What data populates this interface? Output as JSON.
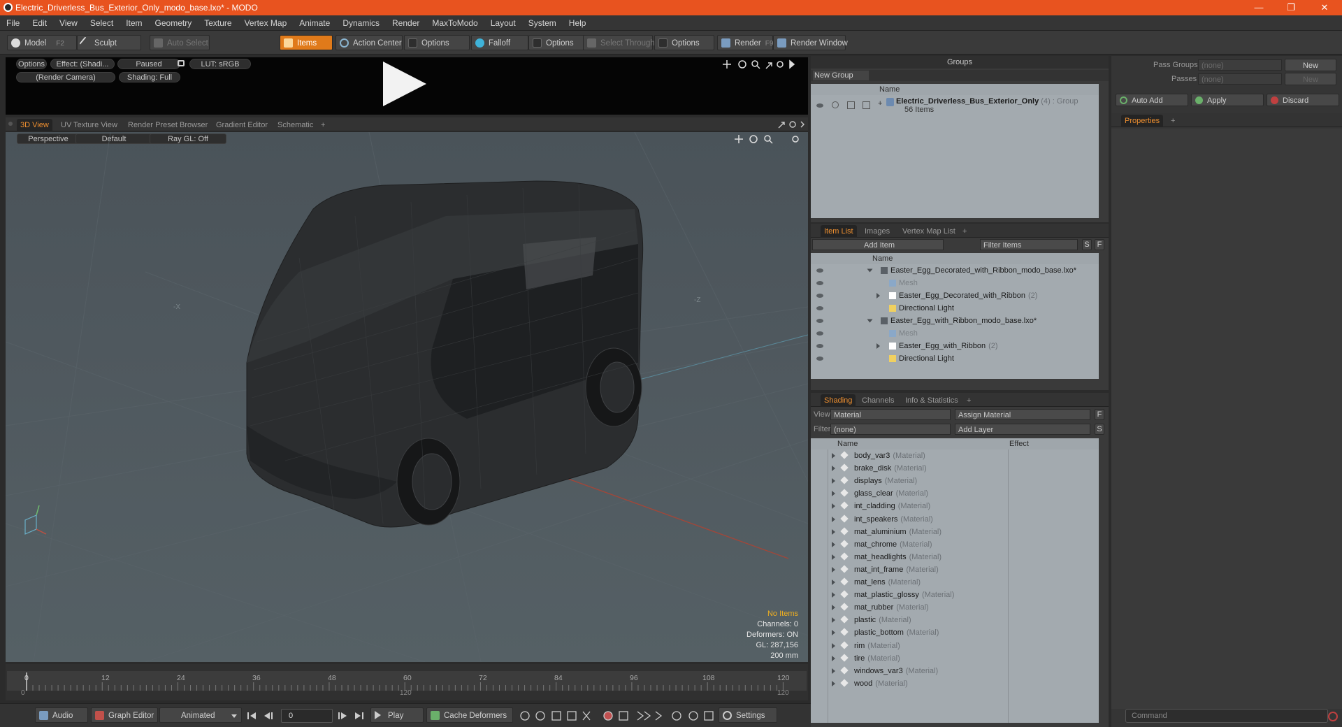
{
  "window": {
    "title": "Electric_Driverless_Bus_Exterior_Only_modo_base.lxo* - MODO",
    "minimize": "—",
    "maximize": "❐",
    "close": "✕"
  },
  "menu": [
    "File",
    "Edit",
    "View",
    "Select",
    "Item",
    "Geometry",
    "Texture",
    "Vertex Map",
    "Animate",
    "Dynamics",
    "Render",
    "MaxToModo",
    "Layout",
    "System",
    "Help"
  ],
  "toolbar": {
    "model": "Model",
    "model_key": "F2",
    "sculpt": "Sculpt",
    "auto_select": "Auto Select",
    "items": "Items",
    "action_center": "Action Center",
    "options1": "Options",
    "falloff": "Falloff",
    "options2": "Options",
    "select_through": "Select Through",
    "options3": "Options",
    "render": "Render",
    "render_key": "F9",
    "render_window": "Render Window"
  },
  "preview": {
    "options": "Options",
    "effect": "Effect: (Shadi...",
    "paused": "Paused",
    "lut": "LUT: sRGB",
    "camera": "(Render Camera)",
    "shading": "Shading: Full"
  },
  "view_tabs": [
    "3D View",
    "UV Texture View",
    "Render Preset Browser",
    "Gradient Editor",
    "Schematic",
    "+"
  ],
  "viewport": {
    "perspective": "Perspective",
    "default": "Default",
    "raygl": "Ray GL: Off",
    "axis_x": "-X",
    "axis_z": "-Z",
    "stats": {
      "no_items": "No Items",
      "channels": "Channels: 0",
      "deformers": "Deformers: ON",
      "gl": "GL: 287,156",
      "size": "200 mm"
    }
  },
  "timeline": {
    "ticks": [
      "0",
      "12",
      "24",
      "36",
      "48",
      "60",
      "72",
      "84",
      "96",
      "108",
      "120"
    ],
    "range_start": "0",
    "range_mid": "120",
    "range_end": "120"
  },
  "bottombar": {
    "audio": "Audio",
    "graph_editor": "Graph Editor",
    "animated": "Animated",
    "frame": "0",
    "play": "Play",
    "cache": "Cache Deformers",
    "settings": "Settings"
  },
  "groups": {
    "title": "Groups",
    "new_group": "New Group",
    "col_name": "Name",
    "item_name": "Electric_Driverless_Bus_Exterior_Only",
    "item_count": "(4)",
    "item_type": ": Group",
    "item_sub": "56 Items"
  },
  "item_list": {
    "tabs": [
      "Item List",
      "Images",
      "Vertex Map List",
      "+"
    ],
    "add_item": "Add Item",
    "filter": "Filter Items",
    "s": "S",
    "f": "F",
    "col_name": "Name",
    "rows": [
      {
        "label": "Easter_Egg_Decorated_with_Ribbon_modo_base.lxo*",
        "dim": "",
        "indent": 0,
        "kind": "scene"
      },
      {
        "label": "Mesh",
        "dim": "",
        "indent": 1,
        "kind": "mesh"
      },
      {
        "label": "Easter_Egg_Decorated_with_Ribbon",
        "dim": "(2)",
        "indent": 1,
        "kind": "group"
      },
      {
        "label": "Directional Light",
        "dim": "",
        "indent": 1,
        "kind": "light"
      },
      {
        "label": "Easter_Egg_with_Ribbon_modo_base.lxo*",
        "dim": "",
        "indent": 0,
        "kind": "scene"
      },
      {
        "label": "Mesh",
        "dim": "",
        "indent": 1,
        "kind": "mesh"
      },
      {
        "label": "Easter_Egg_with_Ribbon",
        "dim": "(2)",
        "indent": 1,
        "kind": "group"
      },
      {
        "label": "Directional Light",
        "dim": "",
        "indent": 1,
        "kind": "light"
      }
    ]
  },
  "shading": {
    "tabs": [
      "Shading",
      "Channels",
      "Info & Statistics",
      "+"
    ],
    "view_label": "View",
    "view_value": "Material",
    "assign": "Assign Material",
    "f": "F",
    "filter_label": "Filter",
    "filter_value": "(none)",
    "add_layer": "Add Layer",
    "s": "S",
    "col_name": "Name",
    "col_effect": "Effect",
    "materials": [
      "body_var3",
      "brake_disk",
      "displays",
      "glass_clear",
      "int_cladding",
      "int_speakers",
      "mat_aluminium",
      "mat_chrome",
      "mat_headlights",
      "mat_int_frame",
      "mat_lens",
      "mat_plastic_glossy",
      "mat_rubber",
      "plastic",
      "plastic_bottom",
      "rim",
      "tire",
      "windows_var3",
      "wood"
    ],
    "material_tag": "(Material)"
  },
  "right": {
    "pass_groups": "Pass Groups",
    "passes": "Passes",
    "none": "(none)",
    "new": "New",
    "auto_add": "Auto Add",
    "apply": "Apply",
    "discard": "Discard",
    "properties": "Properties",
    "plus": "+",
    "command": "Command"
  },
  "colors": {
    "accent": "#e8531f",
    "active_tab": "#f09030",
    "list_bg": "#a3aaaf"
  }
}
